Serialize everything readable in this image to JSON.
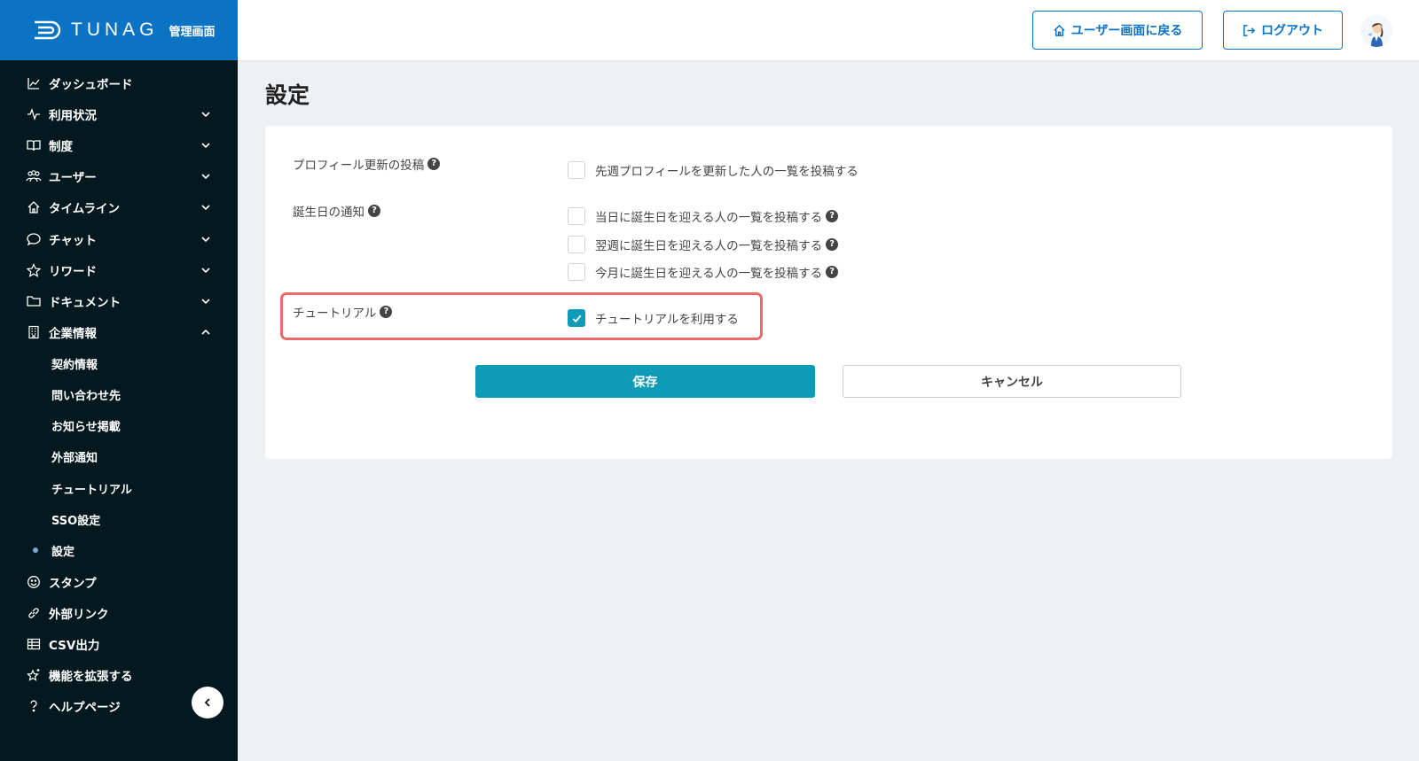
{
  "brand": {
    "name": "TUNAG",
    "subtitle": "管理画面"
  },
  "sidebar": {
    "items": [
      {
        "label": "ダッシュボード",
        "icon": "chart-line-icon",
        "expandable": false
      },
      {
        "label": "利用状況",
        "icon": "pulse-icon",
        "expandable": true
      },
      {
        "label": "制度",
        "icon": "book-icon",
        "expandable": true
      },
      {
        "label": "ユーザー",
        "icon": "users-icon",
        "expandable": true
      },
      {
        "label": "タイムライン",
        "icon": "home-icon",
        "expandable": true
      },
      {
        "label": "チャット",
        "icon": "chat-bubble-icon",
        "expandable": true
      },
      {
        "label": "リワード",
        "icon": "star-icon",
        "expandable": true
      },
      {
        "label": "ドキュメント",
        "icon": "folder-icon",
        "expandable": true
      },
      {
        "label": "企業情報",
        "icon": "building-icon",
        "expandable": true,
        "expanded": true
      }
    ],
    "sub_items": [
      {
        "label": "契約情報"
      },
      {
        "label": "問い合わせ先"
      },
      {
        "label": "お知らせ掲載"
      },
      {
        "label": "外部通知"
      },
      {
        "label": "チュートリアル"
      },
      {
        "label": "SSO設定"
      },
      {
        "label": "設定",
        "active": true
      }
    ],
    "items_after": [
      {
        "label": "スタンプ",
        "icon": "smile-icon"
      },
      {
        "label": "外部リンク",
        "icon": "link-icon"
      },
      {
        "label": "CSV出力",
        "icon": "table-icon"
      },
      {
        "label": "機能を拡張する",
        "icon": "star-plus-icon"
      },
      {
        "label": "ヘルプページ",
        "icon": "question-icon"
      }
    ]
  },
  "header": {
    "home_button": "ユーザー画面に戻る",
    "logout_button": "ログアウト"
  },
  "main": {
    "title": "設定",
    "settings": [
      {
        "label": "プロフィール更新の投稿",
        "options": [
          {
            "text": "先週プロフィールを更新した人の一覧を投稿する",
            "checked": false,
            "help": false
          }
        ]
      },
      {
        "label": "誕生日の通知",
        "options": [
          {
            "text": "当日に誕生日を迎える人の一覧を投稿する",
            "checked": false,
            "help": true
          },
          {
            "text": "翌週に誕生日を迎える人の一覧を投稿する",
            "checked": false,
            "help": true
          },
          {
            "text": "今月に誕生日を迎える人の一覧を投稿する",
            "checked": false,
            "help": true
          }
        ]
      },
      {
        "label": "チュートリアル",
        "options": [
          {
            "text": "チュートリアルを利用する",
            "checked": true,
            "help": false
          }
        ]
      }
    ],
    "save_label": "保存",
    "cancel_label": "キャンセル"
  },
  "colors": {
    "brand_blue": "#0b73c3",
    "sidebar_bg": "#04191f",
    "accent_teal": "#0e9bb8",
    "highlight_red": "#ec6a6a"
  }
}
